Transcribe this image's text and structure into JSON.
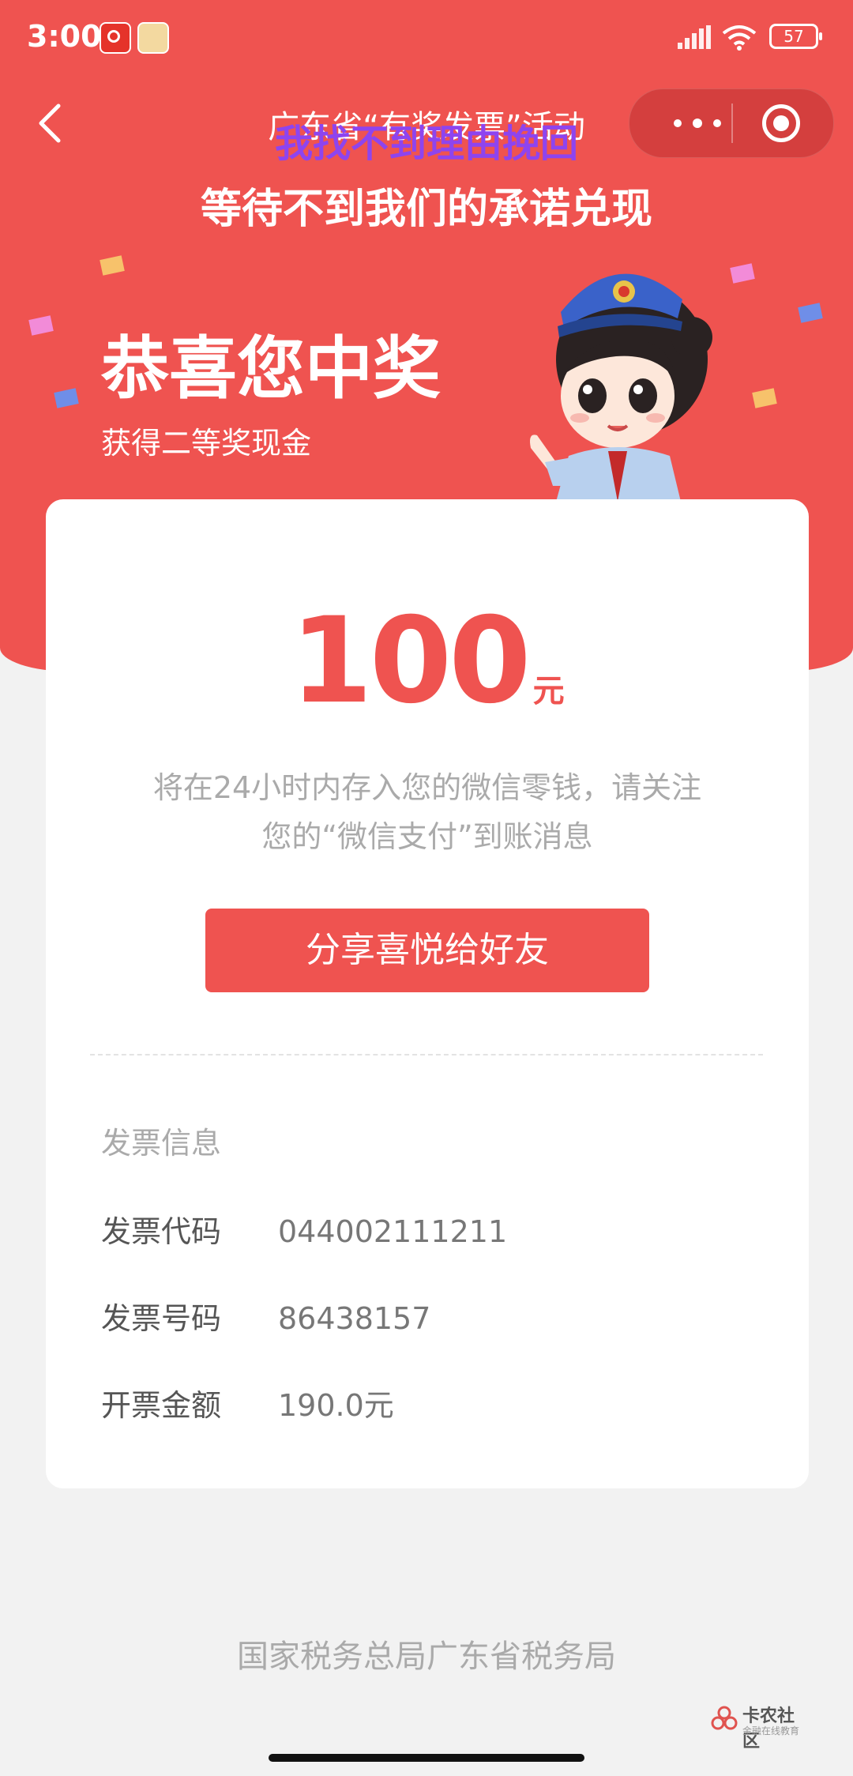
{
  "status_bar": {
    "time": "3:00",
    "battery": "57",
    "icons": [
      "netease-music-icon",
      "game-app-icon",
      "signal-icon",
      "wifi-icon",
      "battery-icon"
    ]
  },
  "nav": {
    "title": "广东省“有奖发票”活动",
    "more_icon": "more-dots-icon",
    "close_icon": "target-close-icon",
    "back_icon": "chevron-left-icon"
  },
  "overlay": {
    "line1": "我找不到理由挽回",
    "line2": "等待不到我们的承诺兑现"
  },
  "hero": {
    "headline": "恭喜您中奖",
    "subtitle": "获得二等奖现金"
  },
  "prize": {
    "amount": "100",
    "unit": "元",
    "notice_line1": "将在24小时内存入您的微信零钱，请关注",
    "notice_line2": "您的“微信支付”到账消息"
  },
  "share_button": "分享喜悦给好友",
  "invoice": {
    "heading": "发票信息",
    "rows": [
      {
        "label": "发票代码",
        "value": "044002111211"
      },
      {
        "label": "发票号码",
        "value": "86438157"
      },
      {
        "label": "开票金额",
        "value": "190.0元"
      }
    ]
  },
  "footer": "国家税务总局广东省税务局",
  "watermark": {
    "title": "卡农社区",
    "subtitle": "金融在线教育"
  },
  "colors": {
    "primary": "#ef5350",
    "background": "#f2f2f2",
    "overlay_purple": "#8e44ef"
  }
}
